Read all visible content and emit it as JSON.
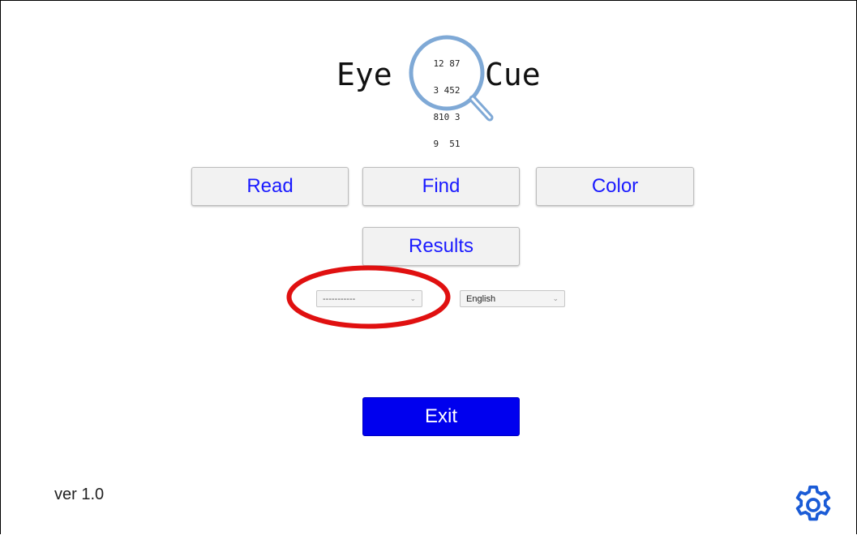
{
  "logo": {
    "word_left": "Eye",
    "word_right": "Cue",
    "lens_lines": [
      "12 87",
      "3 452",
      "810 3",
      "9  51"
    ]
  },
  "buttons": {
    "read": "Read",
    "find": "Find",
    "color": "Color",
    "results": "Results",
    "exit": "Exit"
  },
  "selects": {
    "blank_value": "-----------",
    "language_value": "English"
  },
  "footer": {
    "version": "ver  1.0"
  },
  "icons": {
    "settings": "gear-icon",
    "dropdown": "chevron-down-icon"
  },
  "colors": {
    "button_text": "#1a1aff",
    "exit_bg": "#0000ee",
    "highlight": "#e01010",
    "logo_lens": "#7fa9d6",
    "gear": "#1a5bd6"
  }
}
